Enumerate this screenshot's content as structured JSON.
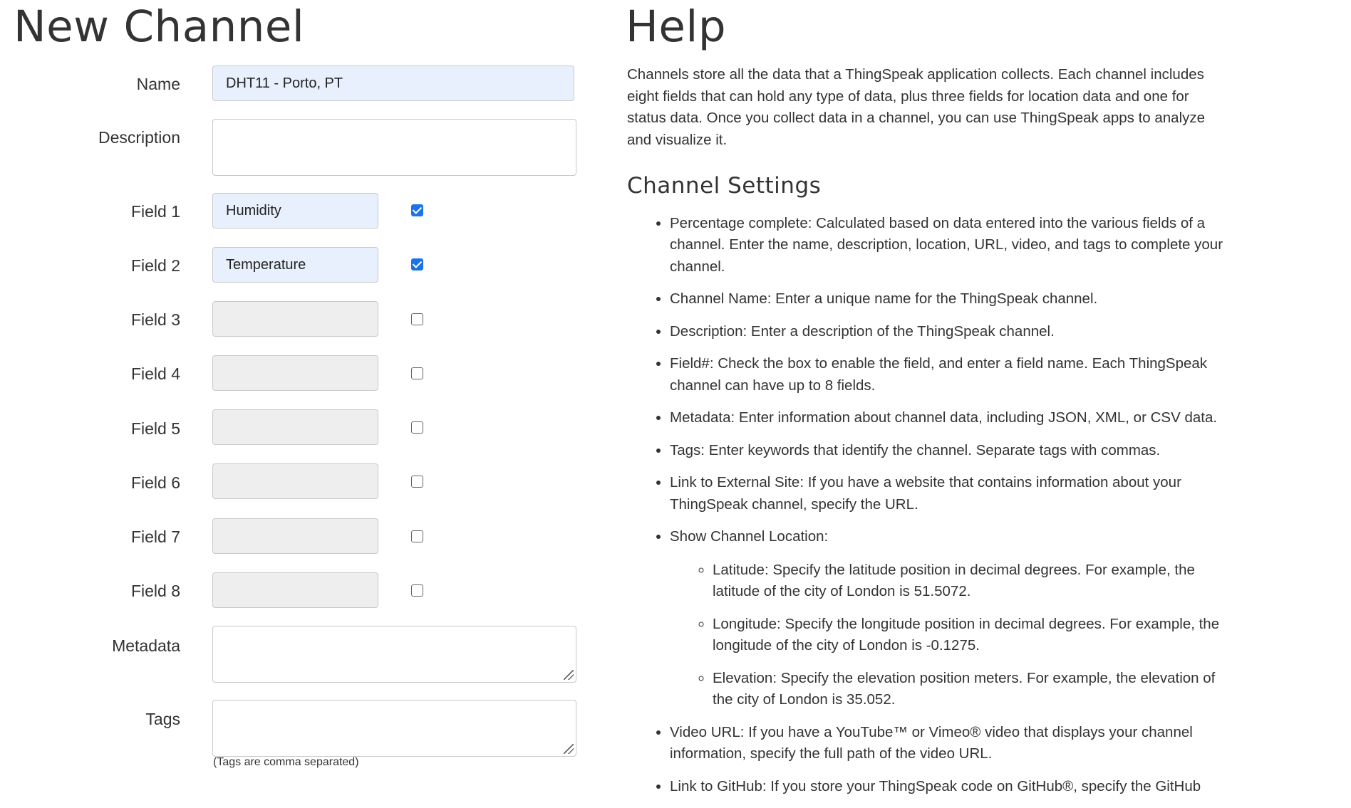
{
  "page_title": "New Channel",
  "help_title": "Help",
  "form": {
    "name_label": "Name",
    "name_value": "DHT11 - Porto, PT",
    "description_label": "Description",
    "description_value": "",
    "fields": [
      {
        "label": "Field 1",
        "value": "Humidity",
        "checked": true
      },
      {
        "label": "Field 2",
        "value": "Temperature",
        "checked": true
      },
      {
        "label": "Field 3",
        "value": "",
        "checked": false
      },
      {
        "label": "Field 4",
        "value": "",
        "checked": false
      },
      {
        "label": "Field 5",
        "value": "",
        "checked": false
      },
      {
        "label": "Field 6",
        "value": "",
        "checked": false
      },
      {
        "label": "Field 7",
        "value": "",
        "checked": false
      },
      {
        "label": "Field 8",
        "value": "",
        "checked": false
      }
    ],
    "metadata_label": "Metadata",
    "tags_label": "Tags",
    "tags_hint": "(Tags are comma separated)"
  },
  "help": {
    "intro": "Channels store all the data that a ThingSpeak application collects. Each channel includes eight fields that can hold any type of data, plus three fields for location data and one for status data. Once you collect data in a channel, you can use ThingSpeak apps to analyze and visualize it.",
    "settings_heading": "Channel Settings",
    "items": [
      "Percentage complete: Calculated based on data entered into the various fields of a channel. Enter the name, description, location, URL, video, and tags to complete your channel.",
      "Channel Name: Enter a unique name for the ThingSpeak channel.",
      "Description: Enter a description of the ThingSpeak channel.",
      "Field#: Check the box to enable the field, and enter a field name. Each ThingSpeak channel can have up to 8 fields.",
      "Metadata: Enter information about channel data, including JSON, XML, or CSV data.",
      "Tags: Enter keywords that identify the channel. Separate tags with commas.",
      "Link to External Site: If you have a website that contains information about your ThingSpeak channel, specify the URL.",
      "Show Channel Location:"
    ],
    "location_items": [
      "Latitude: Specify the latitude position in decimal degrees. For example, the latitude of the city of London is 51.5072.",
      "Longitude: Specify the longitude position in decimal degrees. For example, the longitude of the city of London is -0.1275.",
      "Elevation: Specify the elevation position meters. For example, the elevation of the city of London is 35.052."
    ],
    "video_item": "Video URL: If you have a YouTube™ or Vimeo® video that displays your channel information, specify the full path of the video URL.",
    "cut_item": "Link to GitHub: If you store your ThingSpeak code on GitHub®, specify the GitHub"
  }
}
